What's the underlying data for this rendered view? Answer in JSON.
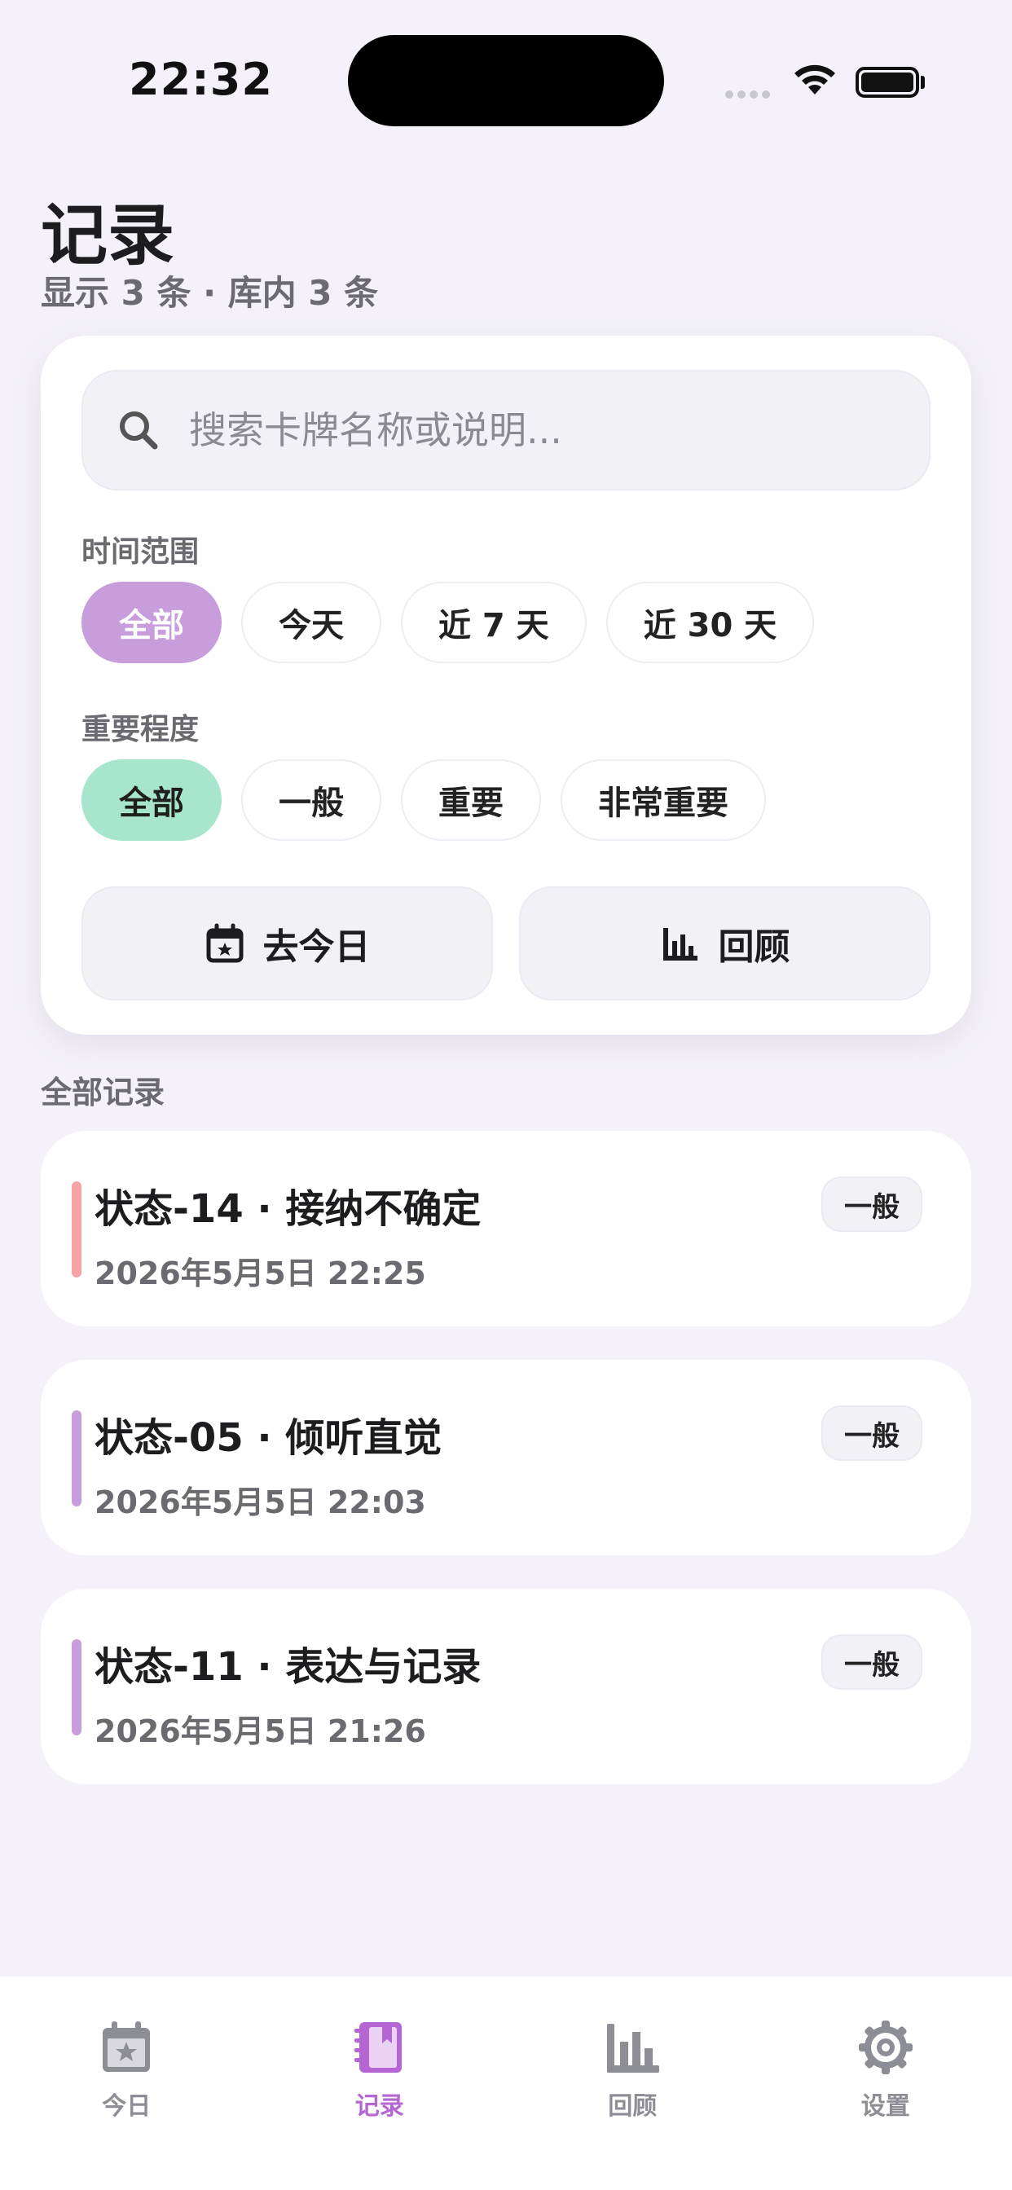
{
  "status_bar": {
    "time": "22:32"
  },
  "header": {
    "title": "记录",
    "subtitle": "显示 3 条 · 库内 3 条"
  },
  "search": {
    "placeholder": "搜索卡牌名称或说明...",
    "value": ""
  },
  "filters": {
    "time_range": {
      "label": "时间范围",
      "options": [
        "全部",
        "今天",
        "近 7 天",
        "近 30 天"
      ],
      "selected": "全部"
    },
    "importance": {
      "label": "重要程度",
      "options": [
        "全部",
        "一般",
        "重要",
        "非常重要"
      ],
      "selected": "全部"
    }
  },
  "actions": {
    "today_label": "去今日",
    "review_label": "回顾"
  },
  "list": {
    "header": "全部记录",
    "records": [
      {
        "title": "状态-14 · 接纳不确定",
        "date": "2026年5月5日 22:25",
        "badge": "一般",
        "accent": "#f5a3a3"
      },
      {
        "title": "状态-05 · 倾听直觉",
        "date": "2026年5月5日 22:03",
        "badge": "一般",
        "accent": "#c79ddc"
      },
      {
        "title": "状态-11 · 表达与记录",
        "date": "2026年5月5日 21:26",
        "badge": "一般",
        "accent": "#c79ddc"
      }
    ]
  },
  "tab_bar": {
    "items": [
      {
        "label": "今日",
        "icon": "calendar-star-icon"
      },
      {
        "label": "记录",
        "icon": "notebook-icon"
      },
      {
        "label": "回顾",
        "icon": "bar-chart-icon"
      },
      {
        "label": "设置",
        "icon": "gear-icon"
      }
    ],
    "active": "记录"
  },
  "colors": {
    "accent": "#b566d4",
    "chip_purple": "#c79ddc",
    "chip_green": "#a7e5cc",
    "background": "#f4f2f8"
  }
}
